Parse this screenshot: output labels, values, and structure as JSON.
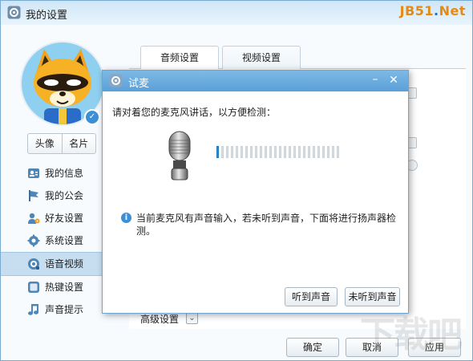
{
  "window": {
    "title": "我的设置",
    "brand_main": "JB51",
    "brand_dot": ".",
    "brand_suffix": "Net"
  },
  "profile": {
    "avatar_buttons": [
      "头像",
      "名片"
    ]
  },
  "sidebar": {
    "items": [
      {
        "label": "我的信息",
        "icon": "user-card-icon"
      },
      {
        "label": "我的公会",
        "icon": "flag-icon"
      },
      {
        "label": "好友设置",
        "icon": "friend-settings-icon"
      },
      {
        "label": "系统设置",
        "icon": "gear-icon"
      },
      {
        "label": "语音视频",
        "icon": "voice-video-icon"
      },
      {
        "label": "热键设置",
        "icon": "keyboard-icon"
      },
      {
        "label": "声音提示",
        "icon": "music-note-icon"
      }
    ],
    "active_index": 4
  },
  "main": {
    "tabs": [
      "音频设置",
      "视频设置"
    ],
    "active_tab": 0,
    "advanced_label": "高级设置"
  },
  "footer": {
    "ok_label": "确定",
    "cancel_label": "取消",
    "apply_label": "应用"
  },
  "dialog": {
    "title": "试麦",
    "prompt": "请对着您的麦克风讲话，以方便检测：",
    "meter": {
      "total_bars": 26,
      "active_bars": 1
    },
    "info": "当前麦克风有声音输入，若未听到声音，下面将进行扬声器检测。",
    "heard_label": "听到声音",
    "not_heard_label": "未听到声音"
  },
  "colors": {
    "accent": "#2b8fd8",
    "dialog_titlebar": "#5aa0d8",
    "active_nav": "#c6def0",
    "brand": "#e58a12"
  }
}
